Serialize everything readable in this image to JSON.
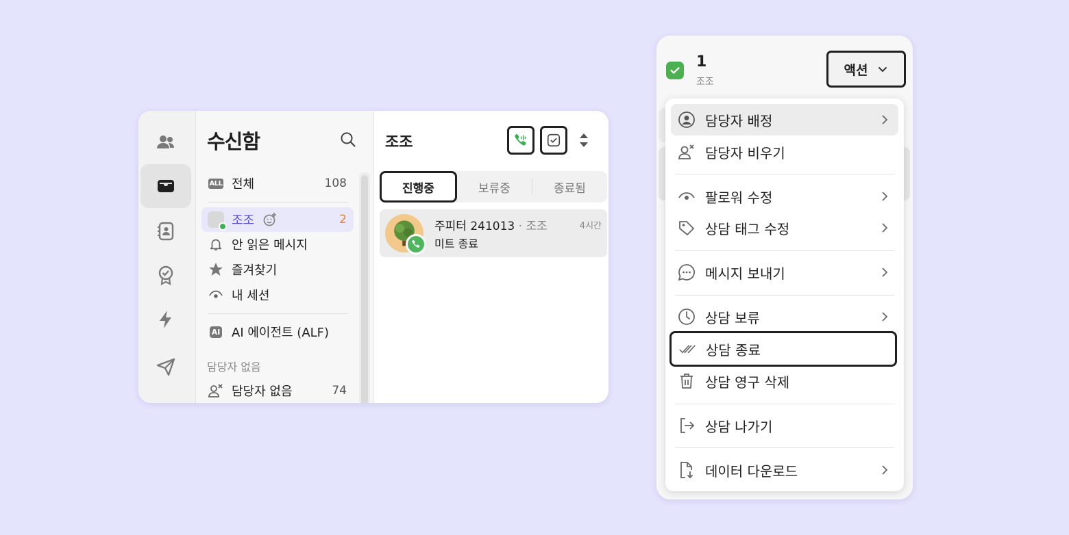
{
  "inbox": {
    "title": "수신함",
    "nav": [
      {
        "label": "전체",
        "count": "108",
        "badge": "ALL"
      },
      {
        "label": "조조",
        "count": "2"
      },
      {
        "label": "안 읽은 메시지"
      },
      {
        "label": "즐겨찾기"
      },
      {
        "label": "내 세션"
      },
      {
        "label": "AI 에이전트 (ALF)",
        "badge": "AI"
      }
    ],
    "section_label": "담당자 없음",
    "unassigned": {
      "label": "담당자 없음",
      "count": "74"
    }
  },
  "conversation_list": {
    "title": "조조",
    "tabs": [
      "진행중",
      "보류중",
      "종료됨"
    ],
    "items": [
      {
        "name": "주피터 241013",
        "assignee": "· 조조",
        "time": "4시간",
        "preview": "미트 종료"
      }
    ]
  },
  "selection_panel": {
    "count": "1",
    "name": "조조",
    "action_label": "액션",
    "menu": [
      {
        "label": "담당자 배정",
        "icon": "user-circle-icon"
      },
      {
        "label": "담당자 비우기",
        "icon": "user-remove-icon"
      },
      {
        "label": "팔로워 수정",
        "icon": "eye-icon"
      },
      {
        "label": "상담 태그 수정",
        "icon": "tag-icon"
      },
      {
        "label": "메시지 보내기",
        "icon": "chat-bubble-icon"
      },
      {
        "label": "상담 보류",
        "icon": "clock-icon"
      },
      {
        "label": "상담 종료",
        "icon": "double-check-icon"
      },
      {
        "label": "상담 영구 삭제",
        "icon": "trash-icon"
      },
      {
        "label": "상담 나가기",
        "icon": "exit-icon"
      },
      {
        "label": "데이터 다운로드",
        "icon": "file-download-icon"
      }
    ]
  },
  "colors": {
    "background": "#e5e4fd",
    "accent": "#5b50d6",
    "unread_count": "#e0822c",
    "success": "#4caf50"
  }
}
